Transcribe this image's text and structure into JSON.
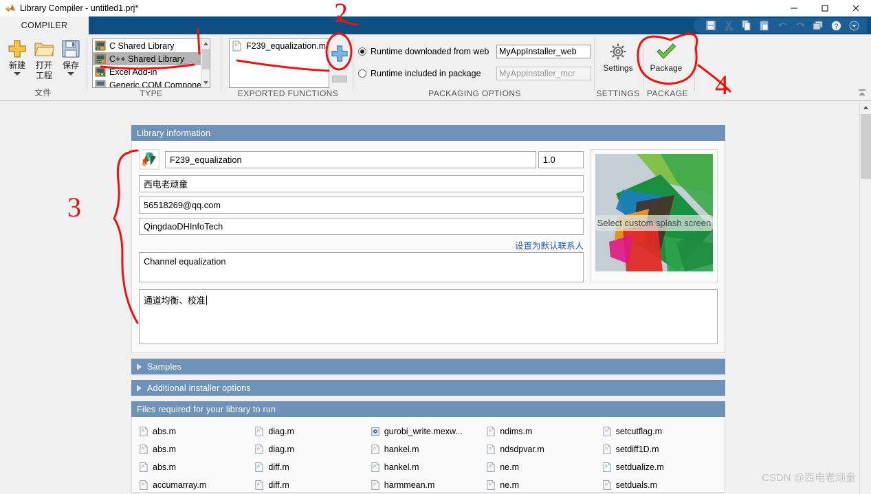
{
  "window": {
    "title": "Library Compiler - untitled1.prj*",
    "icon": "matlab-logo-icon",
    "minimize": "–",
    "maximize": "□",
    "close": "✕"
  },
  "ribbon": {
    "tab_label": "COMPILER",
    "quick_access": [
      {
        "name": "save-icon",
        "glyph": "save"
      },
      {
        "name": "cut-icon",
        "glyph": "cut"
      },
      {
        "name": "copy-icon",
        "glyph": "copy"
      },
      {
        "name": "paste-icon",
        "glyph": "paste"
      },
      {
        "name": "undo-icon",
        "glyph": "undo"
      },
      {
        "name": "redo-icon",
        "glyph": "redo"
      },
      {
        "name": "layout-icon",
        "glyph": "layout"
      },
      {
        "name": "help-icon",
        "glyph": "help"
      },
      {
        "name": "chevron-down-icon",
        "glyph": "chevron"
      }
    ],
    "file_group": {
      "label": "文件",
      "buttons": [
        {
          "label": "新建",
          "label2": "",
          "icon": "new-plus-icon",
          "has_caret": true
        },
        {
          "label": "打开",
          "label2": "工程",
          "icon": "open-folder-icon",
          "has_caret": false
        },
        {
          "label": "保存",
          "label2": "",
          "icon": "save-disk-icon",
          "has_caret": true
        }
      ]
    },
    "type_group": {
      "label": "TYPE",
      "items": [
        {
          "label": "C Shared Library",
          "selected": false
        },
        {
          "label": "C++ Shared Library",
          "selected": true
        },
        {
          "label": "Excel Add-in",
          "selected": false
        },
        {
          "label": "Generic COM Component",
          "selected": false
        }
      ]
    },
    "exported_group": {
      "label": "EXPORTED FUNCTIONS",
      "items": [
        "F239_equalization.m"
      ],
      "add_button": "add-function-button",
      "remove_button": "remove-function-button"
    },
    "packaging_group": {
      "label": "PACKAGING OPTIONS",
      "options": [
        {
          "label": "Runtime downloaded from web",
          "selected": true,
          "field_value": "MyAppInstaller_web",
          "field_disabled": false
        },
        {
          "label": "Runtime included in package",
          "selected": false,
          "field_value": "MyAppInstaller_mcr",
          "field_disabled": true
        }
      ]
    },
    "settings_group": {
      "label": "SETTINGS",
      "button_label": "Settings",
      "icon": "gear-icon"
    },
    "package_group": {
      "label": "PACKAGE",
      "button_label": "Package",
      "icon": "green-check-icon"
    }
  },
  "library_information": {
    "header": "Library information",
    "app_icon": "library-app-icon",
    "name": "F239_equalization",
    "version": "1.0",
    "author": "西电老顽童",
    "email": "56518269@qq.com",
    "company": "QingdaoDHInfoTech",
    "set_default_contact_link": "设置为默认联系人",
    "summary": "Channel equalization",
    "description": "通道均衡、校准",
    "splash_caption": "Select custom splash screen"
  },
  "samples": {
    "header": "Samples"
  },
  "additional_installer_options": {
    "header": "Additional installer options"
  },
  "files_required": {
    "header": "Files required for your library to run",
    "columns": [
      [
        "abs.m",
        "abs.m",
        "abs.m",
        "accumarray.m"
      ],
      [
        "diag.m",
        "diag.m",
        "diff.m",
        "diff.m"
      ],
      [
        "gurobi_write.mexw...",
        "hankel.m",
        "hankel.m",
        "harmmean.m"
      ],
      [
        "ndims.m",
        "ndsdpvar.m",
        "ne.m",
        "ne.m"
      ],
      [
        "setcutflag.m",
        "setdiff1D.m",
        "setdualize.m",
        "setduals.m"
      ]
    ]
  },
  "annotations": {
    "markers": [
      "2",
      "3",
      "4"
    ],
    "color": "#ee1111"
  },
  "watermark": "CSDN @西电老顽童",
  "colors": {
    "titlebar_accent": "#0d4f85",
    "section_header": "#6f92b8",
    "selection": "#b4b4b4",
    "link": "#1a5fb4",
    "annotation_red": "#ee1111"
  }
}
